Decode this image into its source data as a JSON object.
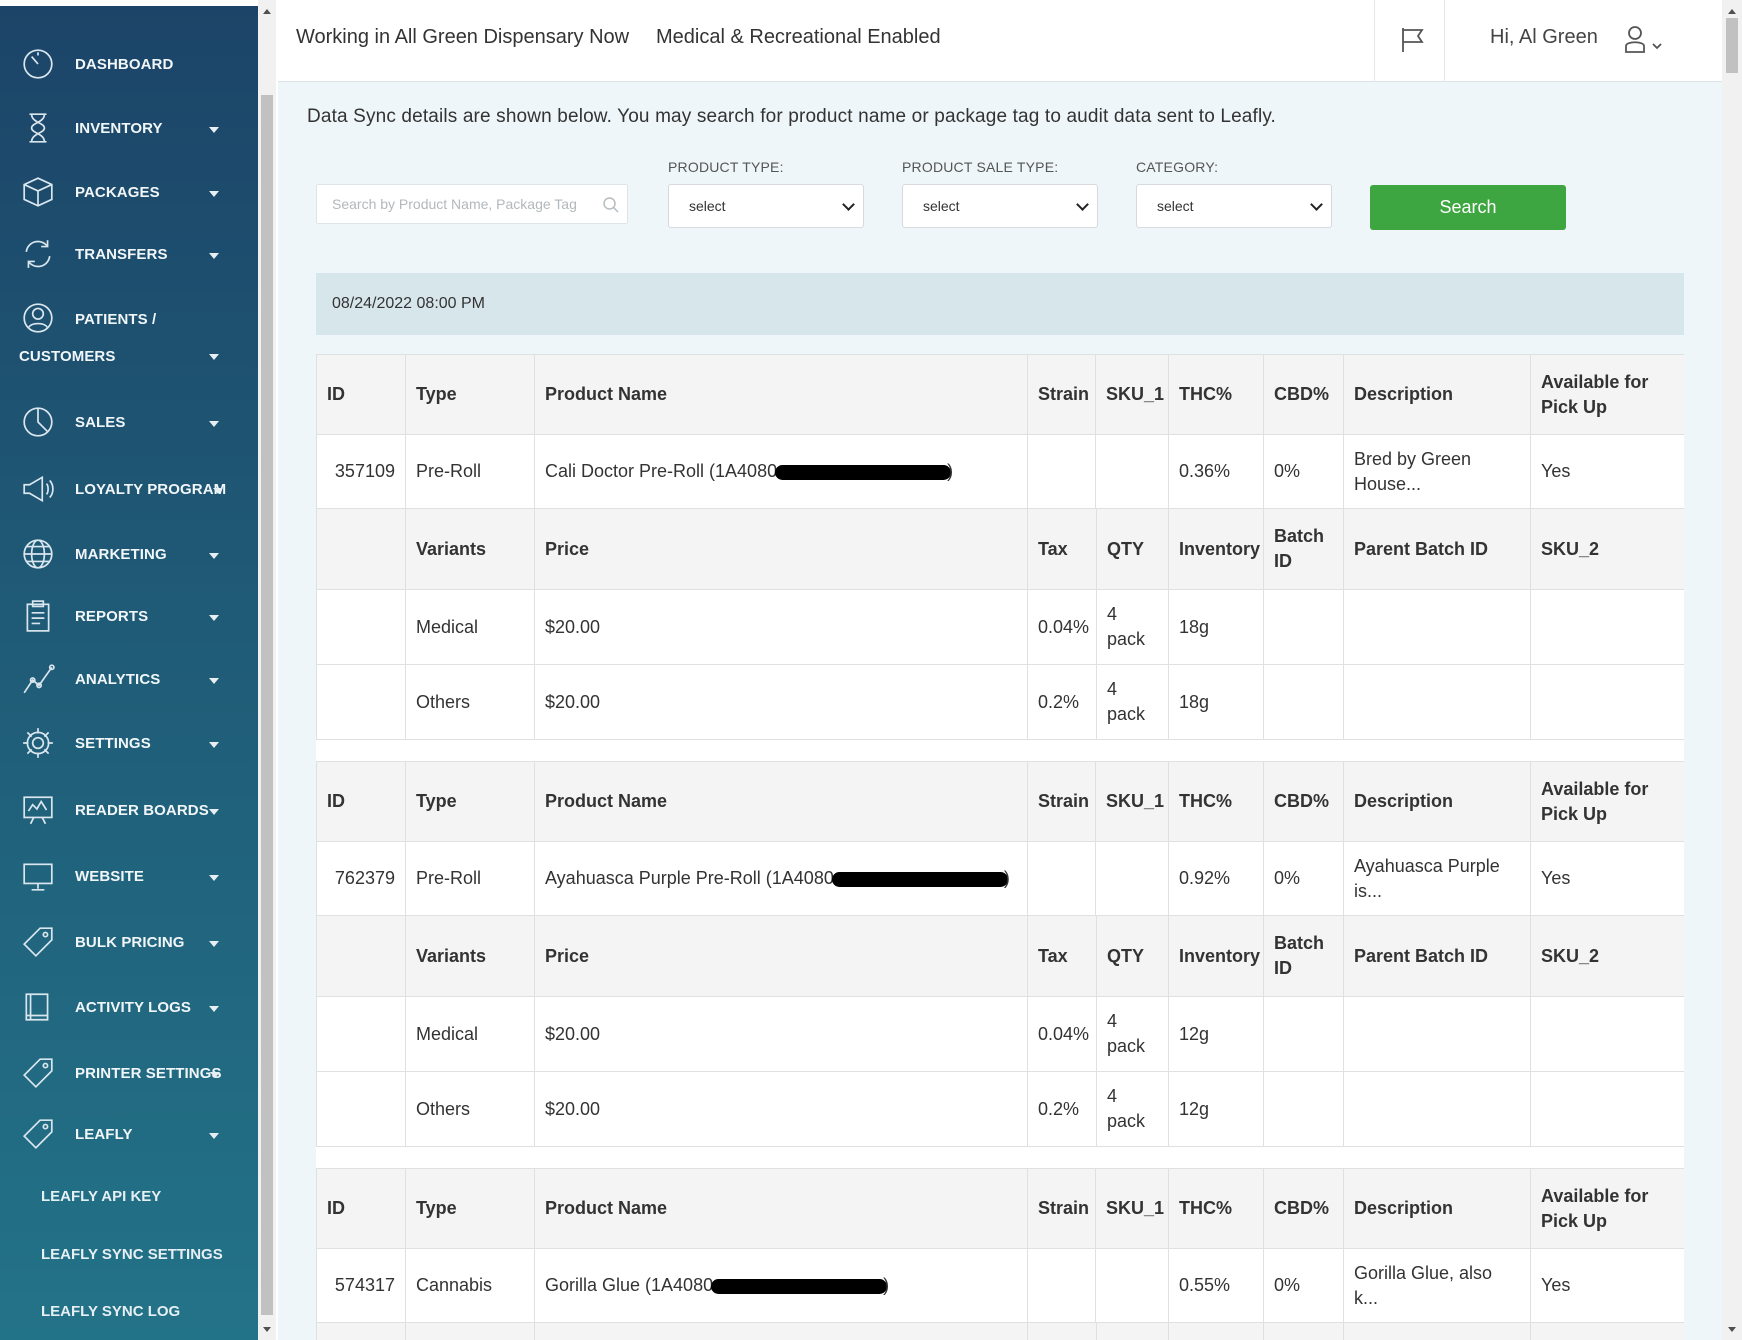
{
  "sidebar": {
    "items": [
      {
        "label": "DASHBOARD",
        "icon": "dashboard-icon",
        "caret": false
      },
      {
        "label": "INVENTORY",
        "icon": "hourglass-icon",
        "caret": true
      },
      {
        "label": "PACKAGES",
        "icon": "box-icon",
        "caret": true
      },
      {
        "label": "TRANSFERS",
        "icon": "transfer-icon",
        "caret": true
      },
      {
        "label": "PATIENTS /",
        "label2": "CUSTOMERS",
        "icon": "user-icon",
        "caret": true
      },
      {
        "label": "SALES",
        "icon": "pie-chart-icon",
        "caret": true
      },
      {
        "label": "LOYALTY PROGRAM",
        "icon": "megaphone-icon",
        "caret": true
      },
      {
        "label": "MARKETING",
        "icon": "globe-icon",
        "caret": true
      },
      {
        "label": "REPORTS",
        "icon": "clipboard-icon",
        "caret": true
      },
      {
        "label": "ANALYTICS",
        "icon": "line-chart-icon",
        "caret": true
      },
      {
        "label": "SETTINGS",
        "icon": "gear-icon",
        "caret": true
      },
      {
        "label": "READER BOARDS",
        "icon": "reader-board-icon",
        "caret": true
      },
      {
        "label": "WEBSITE",
        "icon": "monitor-icon",
        "caret": true
      },
      {
        "label": "BULK PRICING",
        "icon": "tag-icon",
        "caret": true
      },
      {
        "label": "ACTIVITY LOGS",
        "icon": "book-icon",
        "caret": true
      },
      {
        "label": "PRINTER SETTINGS",
        "icon": "tag-icon",
        "caret": true
      },
      {
        "label": "LEAFLY",
        "icon": "tag-icon",
        "caret": true
      }
    ],
    "sub_items": [
      "LEAFLY API KEY",
      "LEAFLY SYNC SETTINGS",
      "LEAFLY SYNC LOG"
    ]
  },
  "header": {
    "working_in": "Working in All Green Dispensary Now",
    "mode": "Medical & Recreational Enabled",
    "greeting": "Hi, Al Green",
    "flag_icon": "flag-icon",
    "user_icon": "user-icon"
  },
  "intro": "Data Sync details are shown below. You may search for product name or package tag to audit data sent to Leafly.",
  "filters": {
    "search_placeholder": "Search by Product Name, Package Tag",
    "product_type_label": "PRODUCT TYPE:",
    "product_type_value": "select",
    "sale_type_label": "PRODUCT SALE TYPE:",
    "sale_type_value": "select",
    "category_label": "CATEGORY:",
    "category_value": "select",
    "search_button": "Search"
  },
  "sync_date": "08/24/2022 08:00 PM",
  "product_headers": [
    "ID",
    "Type",
    "Product Name",
    "Strain",
    "SKU_1",
    "THC%",
    "CBD%",
    "Description",
    "Available for Pick Up"
  ],
  "variant_headers": [
    "Variants",
    "Price",
    "Tax",
    "QTY",
    "Inventory",
    "Batch ID",
    "Parent Batch ID",
    "SKU_2"
  ],
  "products": [
    {
      "id": "357109",
      "type": "Pre-Roll",
      "name": "Cali Doctor Pre-Roll (1A4080",
      "name_end": ")",
      "strain": "",
      "sku1": "",
      "thc": "0.36%",
      "cbd": "0%",
      "description": "Bred by Green House...",
      "pickup": "Yes",
      "variants": [
        {
          "variant": "Medical",
          "price": "$20.00",
          "tax": "0.04%",
          "qty": "4 pack",
          "inventory": "18g",
          "batch": "",
          "parent_batch": "",
          "sku2": ""
        },
        {
          "variant": "Others",
          "price": "$20.00",
          "tax": "0.2%",
          "qty": "4 pack",
          "inventory": "18g",
          "batch": "",
          "parent_batch": "",
          "sku2": ""
        }
      ]
    },
    {
      "id": "762379",
      "type": "Pre-Roll",
      "name": "Ayahuasca Purple Pre-Roll (1A4080",
      "name_end": ")",
      "strain": "",
      "sku1": "",
      "thc": "0.92%",
      "cbd": "0%",
      "description": "Ayahuasca Purple is...",
      "pickup": "Yes",
      "variants": [
        {
          "variant": "Medical",
          "price": "$20.00",
          "tax": "0.04%",
          "qty": "4 pack",
          "inventory": "12g",
          "batch": "",
          "parent_batch": "",
          "sku2": ""
        },
        {
          "variant": "Others",
          "price": "$20.00",
          "tax": "0.2%",
          "qty": "4 pack",
          "inventory": "12g",
          "batch": "",
          "parent_batch": "",
          "sku2": ""
        }
      ]
    },
    {
      "id": "574317",
      "type": "Cannabis",
      "name": "Gorilla Glue (1A4080",
      "name_end": ")",
      "strain": "",
      "sku1": "",
      "thc": "0.55%",
      "cbd": "0%",
      "description": "Gorilla Glue, also k...",
      "pickup": "Yes",
      "variants": []
    }
  ],
  "colors": {
    "sidebar_top": "#1c4468",
    "sidebar_bottom": "#237388",
    "accent_green": "#3ea641",
    "content_bg": "#eef6f9",
    "date_bar": "#d7e6eb"
  }
}
